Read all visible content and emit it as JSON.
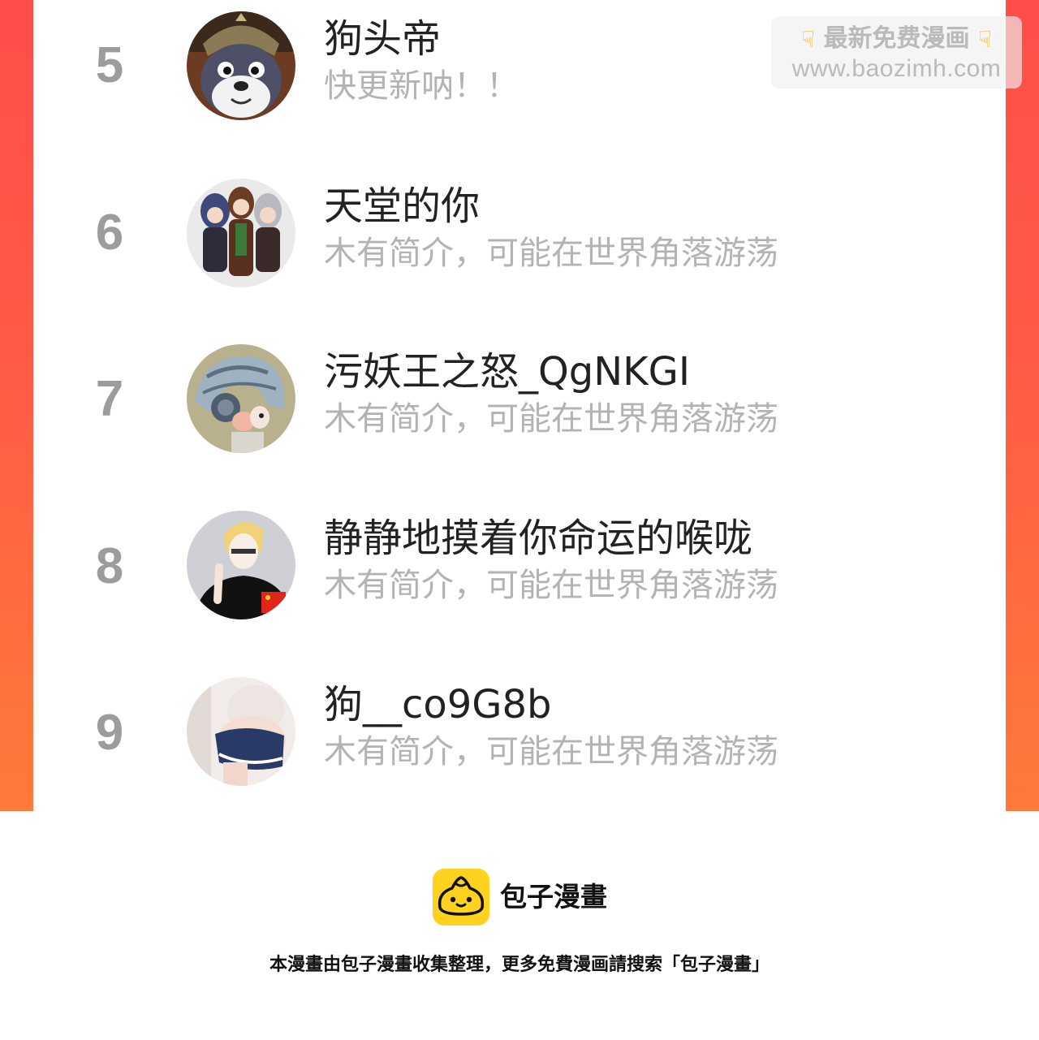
{
  "watermark": {
    "line1": "最新免费漫画",
    "line2": "www.baozimh.com",
    "hand_icon": "pointing-down-hand"
  },
  "ranking": {
    "items": [
      {
        "rank": "5",
        "name": "狗头帝",
        "bio": "快更新呐！！",
        "avatar": "helmet-dog-avatar"
      },
      {
        "rank": "6",
        "name": "天堂的你",
        "bio": "木有简介，可能在世界角落游荡",
        "avatar": "anime-group-avatar"
      },
      {
        "rank": "7",
        "name": "污妖王之怒_QgNKGI",
        "bio": "木有简介，可能在世界角落游荡",
        "avatar": "headphone-boy-avatar"
      },
      {
        "rank": "8",
        "name": "静静地摸着你命运的喉咙",
        "bio": "木有简介，可能在世界角落游荡",
        "avatar": "blond-sketch-avatar"
      },
      {
        "rank": "9",
        "name": "狗__co9G8b",
        "bio": "木有简介，可能在世界角落游荡",
        "avatar": "photo-avatar"
      }
    ]
  },
  "footer": {
    "brand": "包子漫畫",
    "note": "本漫畫由包子漫畫收集整理，更多免費漫画請搜索「包子漫畫」",
    "logo_icon": "baozi-bun-icon"
  },
  "colors": {
    "frame_top": "#ff4d4a",
    "frame_bottom": "#ff7a3a",
    "rank_number": "#9c9c9c",
    "name_text": "#222222",
    "bio_text": "#b3b3b3",
    "logo_yellow": "#ffd21f"
  }
}
